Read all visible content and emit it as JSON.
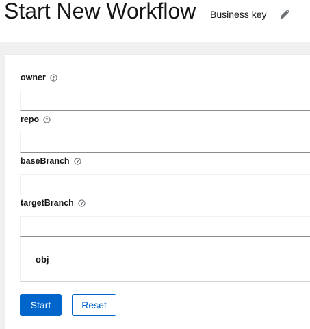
{
  "header": {
    "title": "Start New Workflow",
    "business_key_label": "Business key",
    "edit_icon": "pencil-icon"
  },
  "form": {
    "fields": [
      {
        "label": "owner",
        "value": "",
        "help_icon": "help-circle-icon"
      },
      {
        "label": "repo",
        "value": "",
        "help_icon": "help-circle-icon"
      },
      {
        "label": "baseBranch",
        "value": "",
        "help_icon": "help-circle-icon"
      },
      {
        "label": "targetBranch",
        "value": "",
        "help_icon": "help-circle-icon"
      }
    ],
    "object_section_label": "obj"
  },
  "actions": {
    "start_label": "Start",
    "reset_label": "Reset"
  },
  "colors": {
    "primary": "#0066cc",
    "text": "#151515",
    "page_background": "#f0f0f0",
    "input_underline": "#8a8d90"
  }
}
